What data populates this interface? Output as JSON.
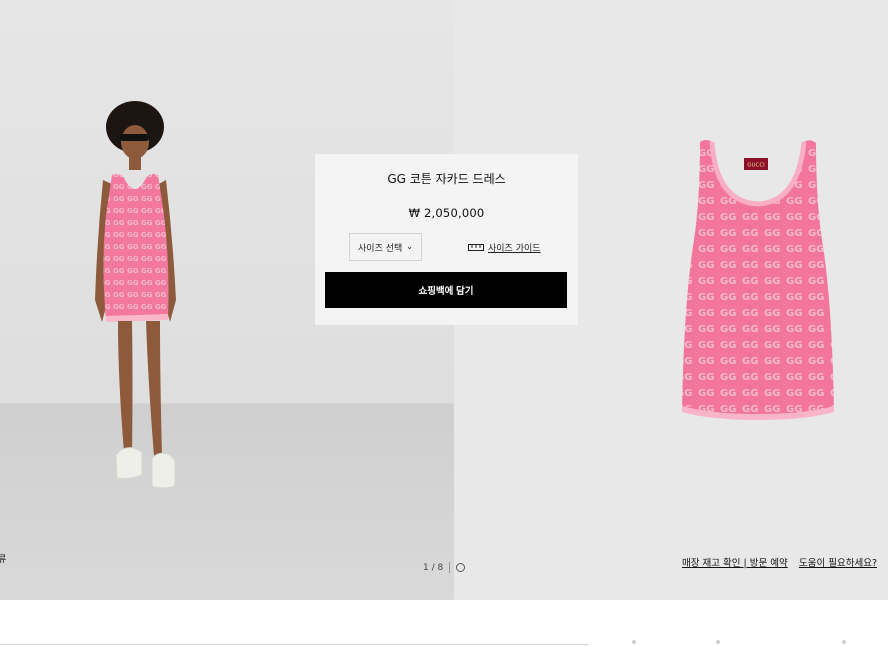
{
  "product": {
    "name": "GG 코튼 자카드 드레스",
    "price": "₩ 2,050,000",
    "size_select_label": "사이즈 선택",
    "size_guide_label": "사이즈 가이드",
    "add_to_bag_label": "쇼핑백에 담기"
  },
  "gallery": {
    "pager_text": "1 / 8",
    "left_cut_text": "류",
    "dress_logo": "GUCCI"
  },
  "links": {
    "store_stock": "매장 재고 확인 | 방문 예약",
    "help": "도움이 필요하세요?"
  },
  "colors": {
    "dress_pink": "#f2759c",
    "pattern_light": "#f9b7cc",
    "button_black": "#000000",
    "card_bg": "#f4f4f4"
  }
}
